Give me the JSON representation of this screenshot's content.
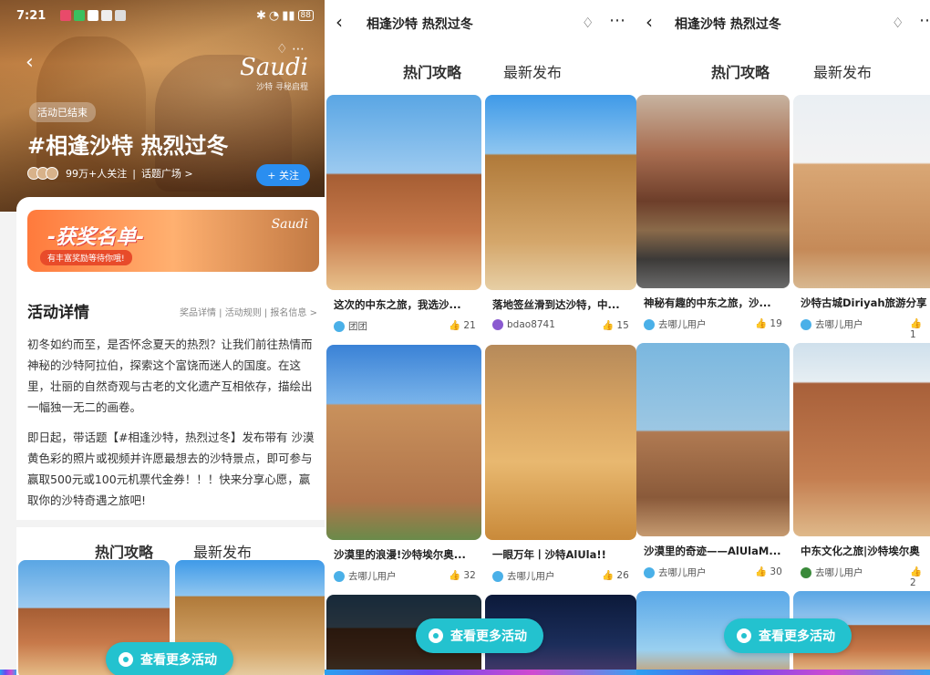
{
  "screen1": {
    "status": {
      "time": "7:21",
      "battery": "88"
    },
    "brand": {
      "logo": "Saudi",
      "slogan": "沙特 寻秘启程"
    },
    "badge": "活动已结束",
    "title": "#相逢沙特 热烈过冬",
    "meta": {
      "followers": "99万+人关注",
      "plaza": "话题广场 >"
    },
    "follow_label": "+ 关注",
    "award": {
      "title": "-获奖名单-",
      "sub": "有丰富奖励等待你哦!",
      "logo": "Saudi"
    },
    "detail_title": "活动详情",
    "detail_links": "奖品详情 | 活动规则 | 报名信息 >",
    "detail_p1": "初冬如约而至，是否怀念夏天的热烈？让我们前往热情而神秘的沙特阿拉伯，探索这个富饶而迷人的国度。在这里，壮丽的自然奇观与古老的文化遗产互相依存，描绘出一幅独一无二的画卷。",
    "detail_p2": "即日起，带话题【#相逢沙特，热烈过冬】发布带有 沙漠黄色彩的照片或视频并许愿最想去的沙特景点，即可参与赢取500元或100元机票代金券！！！快来分享心愿，赢取你的沙特奇遇之旅吧!",
    "tabs": [
      "热门攻略",
      "最新发布"
    ],
    "more_label": "查看更多活动"
  },
  "screen2": {
    "nav_title": "相逢沙特 热烈过冬",
    "tabs": [
      "热门攻略",
      "最新发布"
    ],
    "items": [
      {
        "caption": "这次的中东之旅，我选沙...",
        "user": "团团",
        "likes": "21"
      },
      {
        "caption": "落地签丝滑到达沙特，中...",
        "user": "bdao8741",
        "likes": "15"
      },
      {
        "caption": "沙漠里的浪漫!沙特埃尔奥...",
        "user": "去哪儿用户",
        "likes": "32"
      },
      {
        "caption": "一眼万年丨沙特AlUla!!",
        "user": "去哪儿用户",
        "likes": "26"
      }
    ],
    "more_label": "查看更多活动"
  },
  "screen3": {
    "nav_title": "相逢沙特 热烈过冬",
    "tabs": [
      "热门攻略",
      "最新发布"
    ],
    "items": [
      {
        "caption": "神秘有趣的中东之旅，沙...",
        "user": "去哪儿用户",
        "likes": "19"
      },
      {
        "caption": "沙特古城Diriyah旅游分享",
        "user": "去哪儿用户",
        "likes": "1"
      },
      {
        "caption": "沙漠里的奇迹——AlUlaM...",
        "user": "去哪儿用户",
        "likes": "30"
      },
      {
        "caption": "中东文化之旅|沙特埃尔奥",
        "user": "去哪儿用户",
        "likes": "2"
      }
    ],
    "more_label": "查看更多活动"
  }
}
